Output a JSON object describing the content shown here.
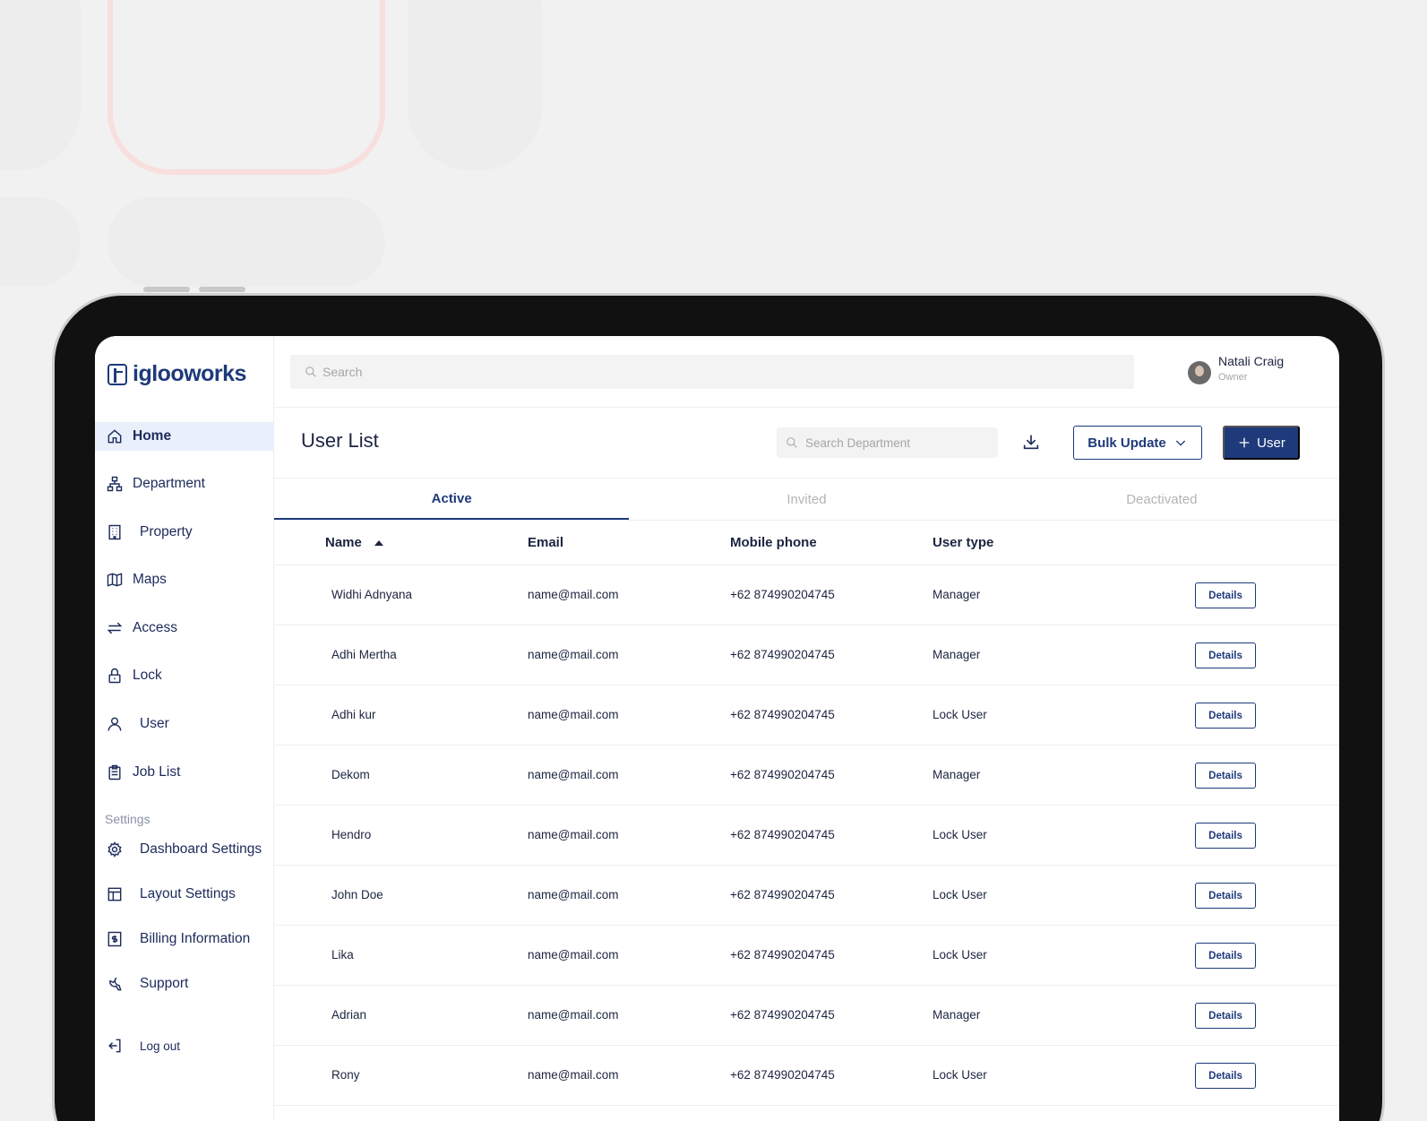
{
  "app": {
    "logo_text": "iglooworks"
  },
  "search": {
    "placeholder": "Search"
  },
  "user": {
    "name": "Natali Craig",
    "role": "Owner"
  },
  "sidebar": {
    "items": [
      {
        "label": "Home",
        "icon": "home-icon"
      },
      {
        "label": "Department",
        "icon": "hierarchy-icon"
      },
      {
        "label": "Property",
        "icon": "building-icon"
      },
      {
        "label": "Maps",
        "icon": "map-icon"
      },
      {
        "label": "Access",
        "icon": "arrows-exchange-icon"
      },
      {
        "label": "Lock",
        "icon": "lock-icon"
      },
      {
        "label": "User",
        "icon": "user-icon"
      },
      {
        "label": "Job List",
        "icon": "clipboard-icon"
      }
    ],
    "settings_label": "Settings",
    "settings_items": [
      {
        "label": "Dashboard Settings",
        "icon": "gear-icon"
      },
      {
        "label": "Layout Settings",
        "icon": "layout-icon"
      },
      {
        "label": "Billing Information",
        "icon": "billing-icon"
      },
      {
        "label": "Support",
        "icon": "support-icon"
      }
    ],
    "logout_label": "Log out"
  },
  "page": {
    "title": "User List",
    "dept_search_placeholder": "Search Department",
    "bulk_update_label": "Bulk Update",
    "add_user_label": "User"
  },
  "tabs": [
    {
      "label": "Active",
      "active": true
    },
    {
      "label": "Invited",
      "active": false
    },
    {
      "label": "Deactivated",
      "active": false
    }
  ],
  "table": {
    "columns": [
      "Name",
      "Email",
      "Mobile phone",
      "User type"
    ],
    "details_label": "Details",
    "rows": [
      {
        "name": "Widhi Adnyana",
        "email": "name@mail.com",
        "phone": "+62 874990204745",
        "type": "Manager"
      },
      {
        "name": "Adhi Mertha",
        "email": "name@mail.com",
        "phone": "+62 874990204745",
        "type": "Manager"
      },
      {
        "name": "Adhi kur",
        "email": "name@mail.com",
        "phone": "+62 874990204745",
        "type": "Lock User"
      },
      {
        "name": "Dekom",
        "email": "name@mail.com",
        "phone": "+62 874990204745",
        "type": "Manager"
      },
      {
        "name": "Hendro",
        "email": "name@mail.com",
        "phone": "+62 874990204745",
        "type": "Lock User"
      },
      {
        "name": "John Doe",
        "email": "name@mail.com",
        "phone": "+62 874990204745",
        "type": "Lock User"
      },
      {
        "name": "Lika",
        "email": "name@mail.com",
        "phone": "+62 874990204745",
        "type": "Lock User"
      },
      {
        "name": "Adrian",
        "email": "name@mail.com",
        "phone": "+62 874990204745",
        "type": "Manager"
      },
      {
        "name": "Rony",
        "email": "name@mail.com",
        "phone": "+62 874990204745",
        "type": "Lock User"
      }
    ]
  },
  "colors": {
    "brand": "#1e3a7b",
    "active_bg": "#e9f0fb"
  }
}
